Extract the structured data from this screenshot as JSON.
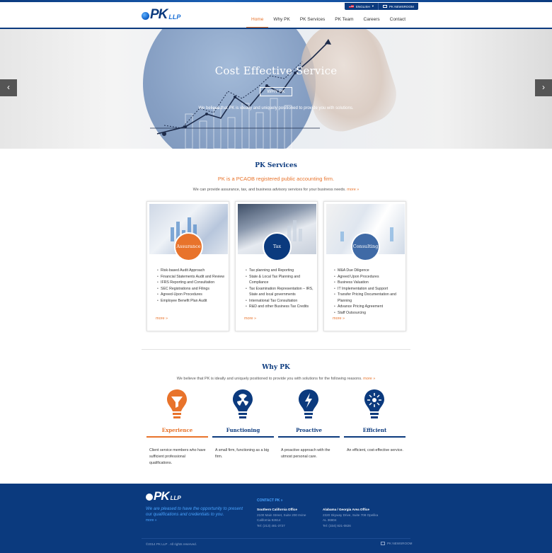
{
  "utility": {
    "language": "ENGLISH",
    "newsroom": "PK NEWSROOM"
  },
  "brand": {
    "name": "PK",
    "suffix": "LLP"
  },
  "nav": {
    "items": [
      "Home",
      "Why PK",
      "PK Services",
      "PK Team",
      "Careers",
      "Contact"
    ],
    "active": "Home"
  },
  "hero": {
    "title": "Cost Effective Service",
    "button": "WHY PK",
    "subtitle": "We believe that PK is ideally and uniquely positioned to provide you with solutions."
  },
  "services": {
    "title": "PK Services",
    "tagline": "PK is a PCAOB registered public accounting firm.",
    "intro": "We can provide assurance, tax, and business advisory services for your business needs.",
    "intro_more": "more »",
    "cards": [
      {
        "label": "Assurance",
        "items": [
          "Risk-based Audit Approach",
          "Financial Statements Audit and Review",
          "IFRS Reporting and Consultation",
          "SEC Registrations and Filings",
          "Agreed-Upon Procedures",
          "Employee Benefit Plan Audit"
        ],
        "more": "more »"
      },
      {
        "label": "Tax",
        "items": [
          "Tax planning and Reporting",
          "State & Local Tax Planning and Compliance",
          "Tax Examination Representation – IRS, State and local governments",
          "International Tax Consultation",
          "R&D and other Business Tax Credits"
        ],
        "more": "more »"
      },
      {
        "label": "Consulting",
        "items": [
          "M&A Due Diligence",
          "Agreed Upon Procedures",
          "Business Valuation",
          "IT Implementation and Support",
          "Transfer Pricing Documentation and Planning",
          "Advance Pricing Agreement",
          "Staff Outsourcing"
        ],
        "more": "more »"
      }
    ]
  },
  "why": {
    "title": "Why PK",
    "intro": "We believe that PK is ideally and uniquely positioned to provide you with solutions for the following reasons.",
    "intro_more": "more »",
    "items": [
      {
        "label": "Experience",
        "desc": "Client service members who have sufficient professional qualifications.",
        "color": "#e8732b",
        "icon": "filter-bulb-icon"
      },
      {
        "label": "Functioning",
        "desc": "A small firm, functioning as a big firm.",
        "color": "#0b3a7e",
        "icon": "radiation-bulb-icon"
      },
      {
        "label": "Proactive",
        "desc": "A proactive approach with the utmost personal care.",
        "color": "#0b3a7e",
        "icon": "lightning-bulb-icon"
      },
      {
        "label": "Efficient",
        "desc": "An efficient, cost-effective service.",
        "color": "#0b3a7e",
        "icon": "burst-bulb-icon"
      }
    ]
  },
  "footer": {
    "tagline": "We are pleased to have the opportunity to present our qualifications and credentials to you.",
    "more": "more »",
    "contact": "CONTACT PK »",
    "offices": [
      {
        "name": "Southern California Office",
        "address1": "2100 Main Street, Suite 200 Irvine",
        "address2": "California 92614",
        "tel": "Tel: (213) 481-3727"
      },
      {
        "name": "Alabama / Georgia Area Office",
        "address1": "2320 Skyway Drive, Suite 708 Opelika",
        "address2": "AL 36804",
        "tel": "Tel: (334) 821-0826"
      }
    ],
    "copyright": "©2014 PK LLP . All rights reserved.",
    "newsroom": "PK NEWSROOM"
  },
  "colors": {
    "navy": "#0b3a7e",
    "orange": "#e8732b",
    "link_blue": "#4aa4ff"
  }
}
